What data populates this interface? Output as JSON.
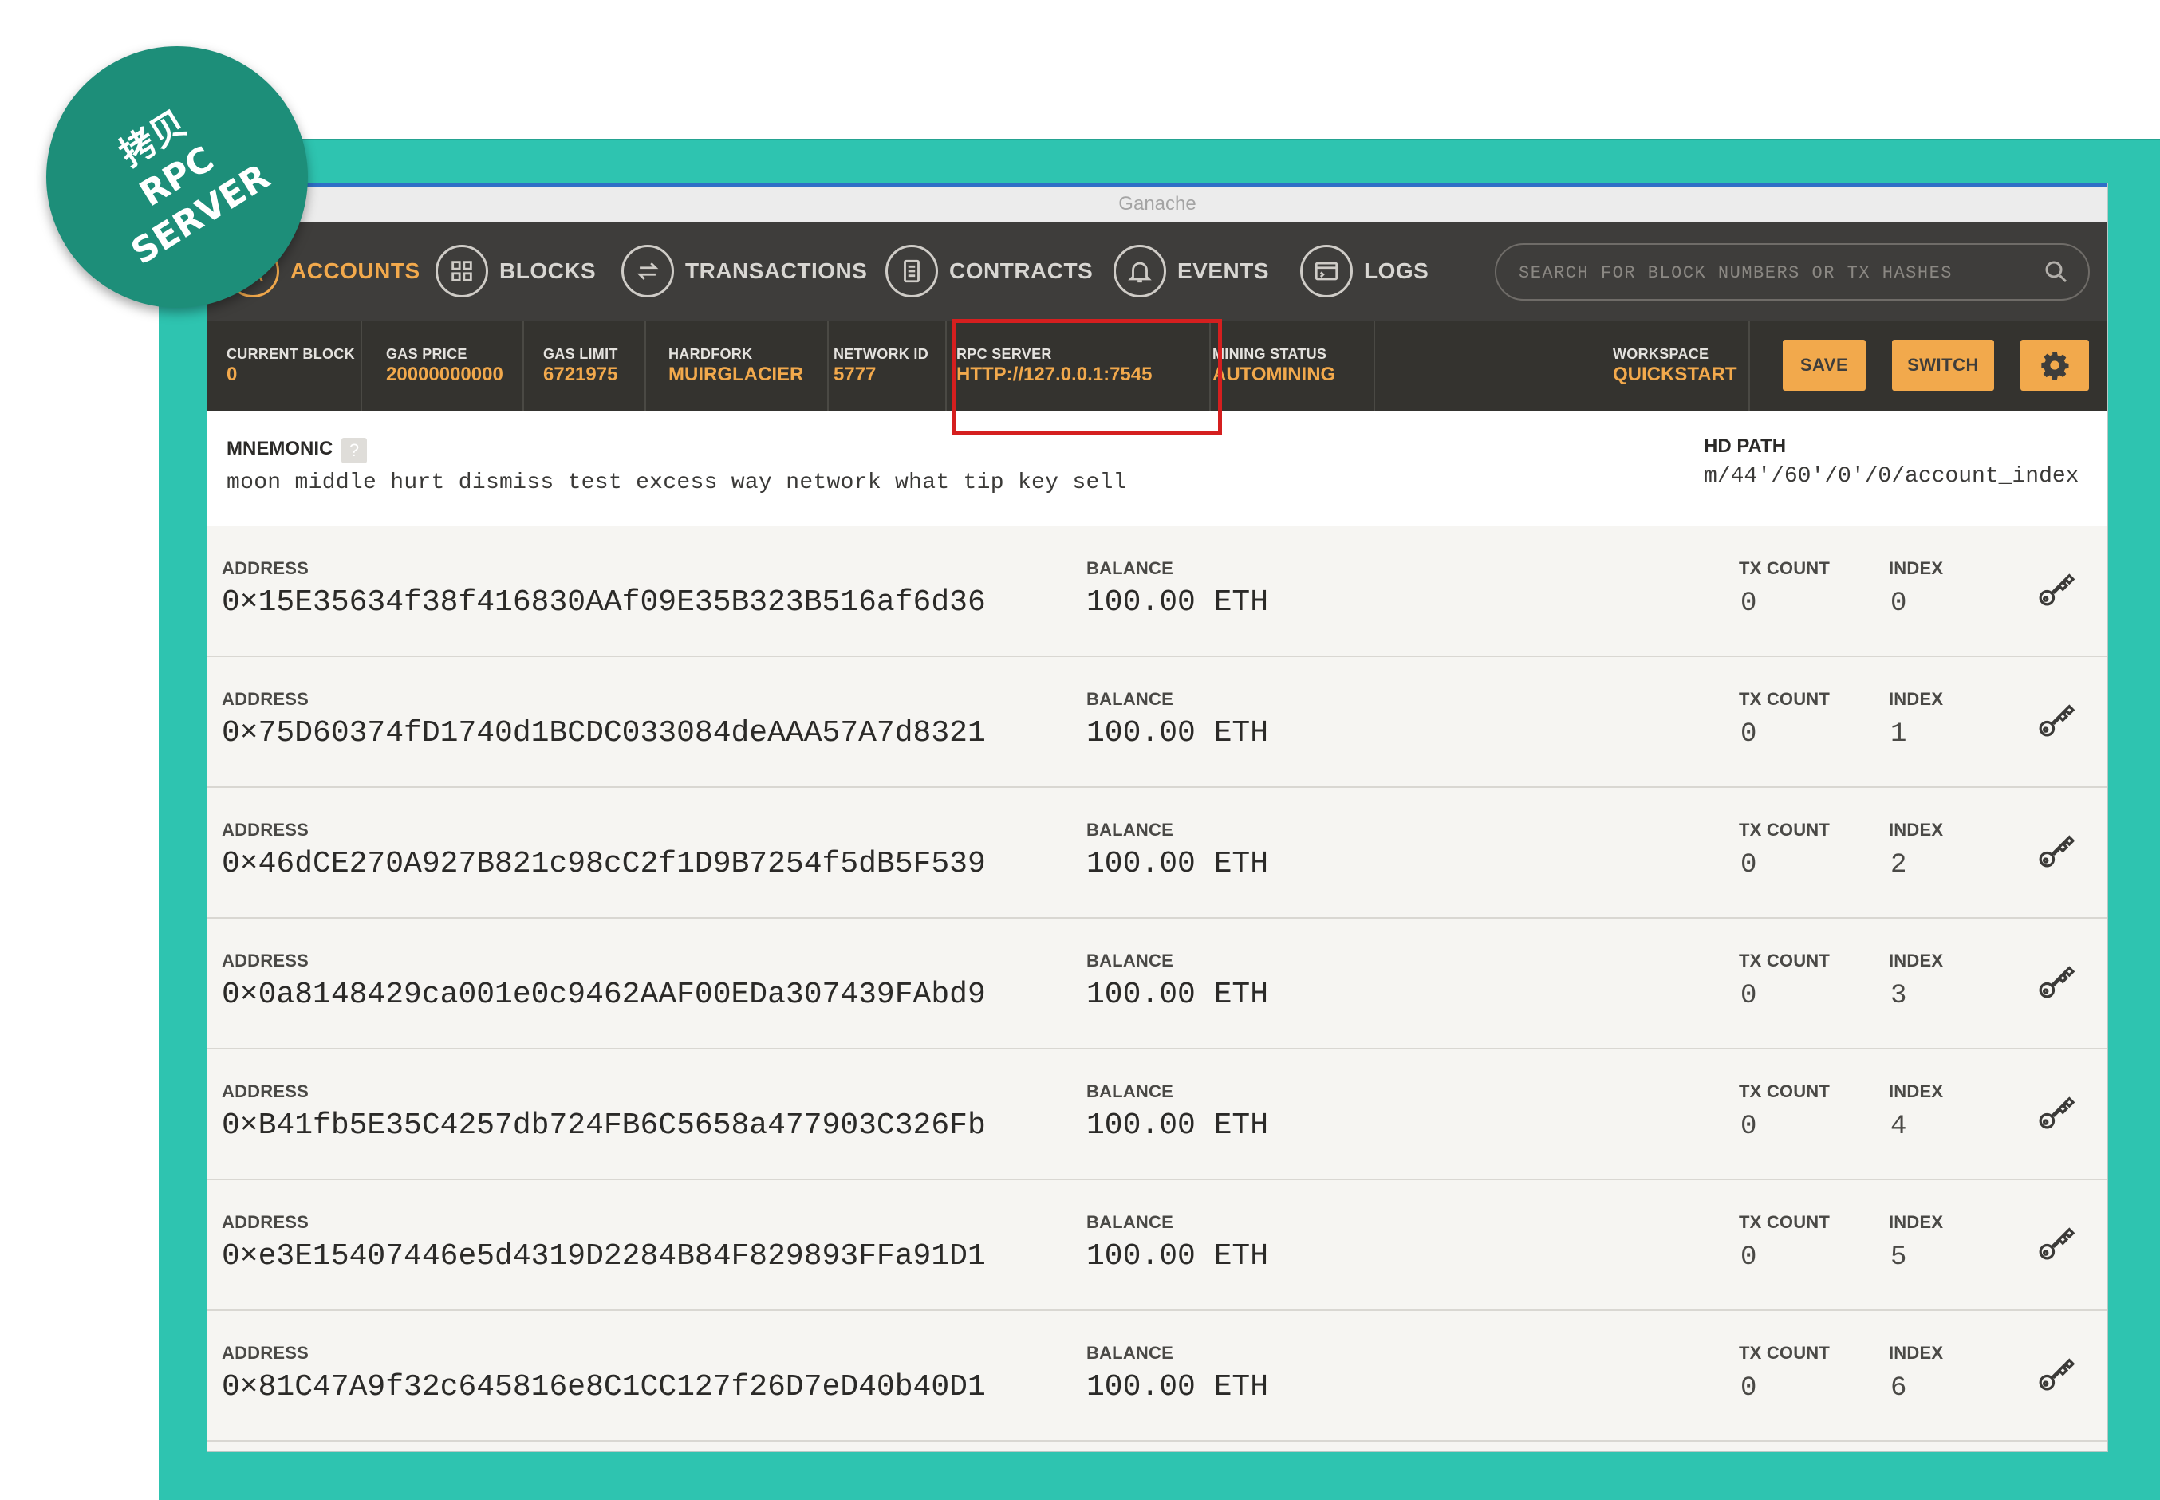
{
  "window_title": "Ganache",
  "badge": {
    "line1": "拷贝",
    "line2": "RPC",
    "line3": "SERVER"
  },
  "nav": {
    "items": [
      {
        "label": "ACCOUNTS",
        "icon": "accounts-icon"
      },
      {
        "label": "BLOCKS",
        "icon": "blocks-icon"
      },
      {
        "label": "TRANSACTIONS",
        "icon": "transactions-icon"
      },
      {
        "label": "CONTRACTS",
        "icon": "contracts-icon"
      },
      {
        "label": "EVENTS",
        "icon": "bell-icon"
      },
      {
        "label": "LOGS",
        "icon": "logs-icon"
      }
    ],
    "search_placeholder": "SEARCH FOR BLOCK NUMBERS OR TX HASHES"
  },
  "status": {
    "current_block": {
      "label": "CURRENT BLOCK",
      "value": "0"
    },
    "gas_price": {
      "label": "GAS PRICE",
      "value": "20000000000"
    },
    "gas_limit": {
      "label": "GAS LIMIT",
      "value": "6721975"
    },
    "hardfork": {
      "label": "HARDFORK",
      "value": "MUIRGLACIER"
    },
    "network_id": {
      "label": "NETWORK ID",
      "value": "5777"
    },
    "rpc_server": {
      "label": "RPC SERVER",
      "value": "HTTP://127.0.0.1:7545"
    },
    "mining_status": {
      "label": "MINING STATUS",
      "value": "AUTOMINING"
    },
    "workspace": {
      "label": "WORKSPACE",
      "value": "QUICKSTART"
    },
    "save_label": "SAVE",
    "switch_label": "SWITCH"
  },
  "mnemonic": {
    "label": "MNEMONIC",
    "help": "?",
    "words": "moon middle hurt dismiss test excess way network what tip key sell",
    "hd_path_label": "HD PATH",
    "hd_path": "m/44'/60'/0'/0/account_index"
  },
  "columns": {
    "address": "ADDRESS",
    "balance": "BALANCE",
    "tx_count": "TX COUNT",
    "index": "INDEX"
  },
  "accounts": [
    {
      "address": "0×15E35634f38f416830AAf09E35B323B516af6d36",
      "balance": "100.00 ETH",
      "tx_count": "0",
      "index": "0"
    },
    {
      "address": "0×75D60374fD1740d1BCDC033084deAAA57A7d8321",
      "balance": "100.00 ETH",
      "tx_count": "0",
      "index": "1"
    },
    {
      "address": "0×46dCE270A927B821c98cC2f1D9B7254f5dB5F539",
      "balance": "100.00 ETH",
      "tx_count": "0",
      "index": "2"
    },
    {
      "address": "0×0a8148429ca001e0c9462AAF00EDa307439FAbd9",
      "balance": "100.00 ETH",
      "tx_count": "0",
      "index": "3"
    },
    {
      "address": "0×B41fb5E35C4257db724FB6C5658a477903C326Fb",
      "balance": "100.00 ETH",
      "tx_count": "0",
      "index": "4"
    },
    {
      "address": "0×e3E15407446e5d4319D2284B84F829893FFa91D1",
      "balance": "100.00 ETH",
      "tx_count": "0",
      "index": "5"
    },
    {
      "address": "0×81C47A9f32c645816e8C1CC127f26D7eD40b40D1",
      "balance": "100.00 ETH",
      "tx_count": "0",
      "index": "6"
    }
  ],
  "colors": {
    "accent": "#f2a94c",
    "frame": "#2ec4b0",
    "badge": "#1d8e79",
    "highlight": "#d51f1f",
    "nav_bg": "#3e3d3b"
  }
}
